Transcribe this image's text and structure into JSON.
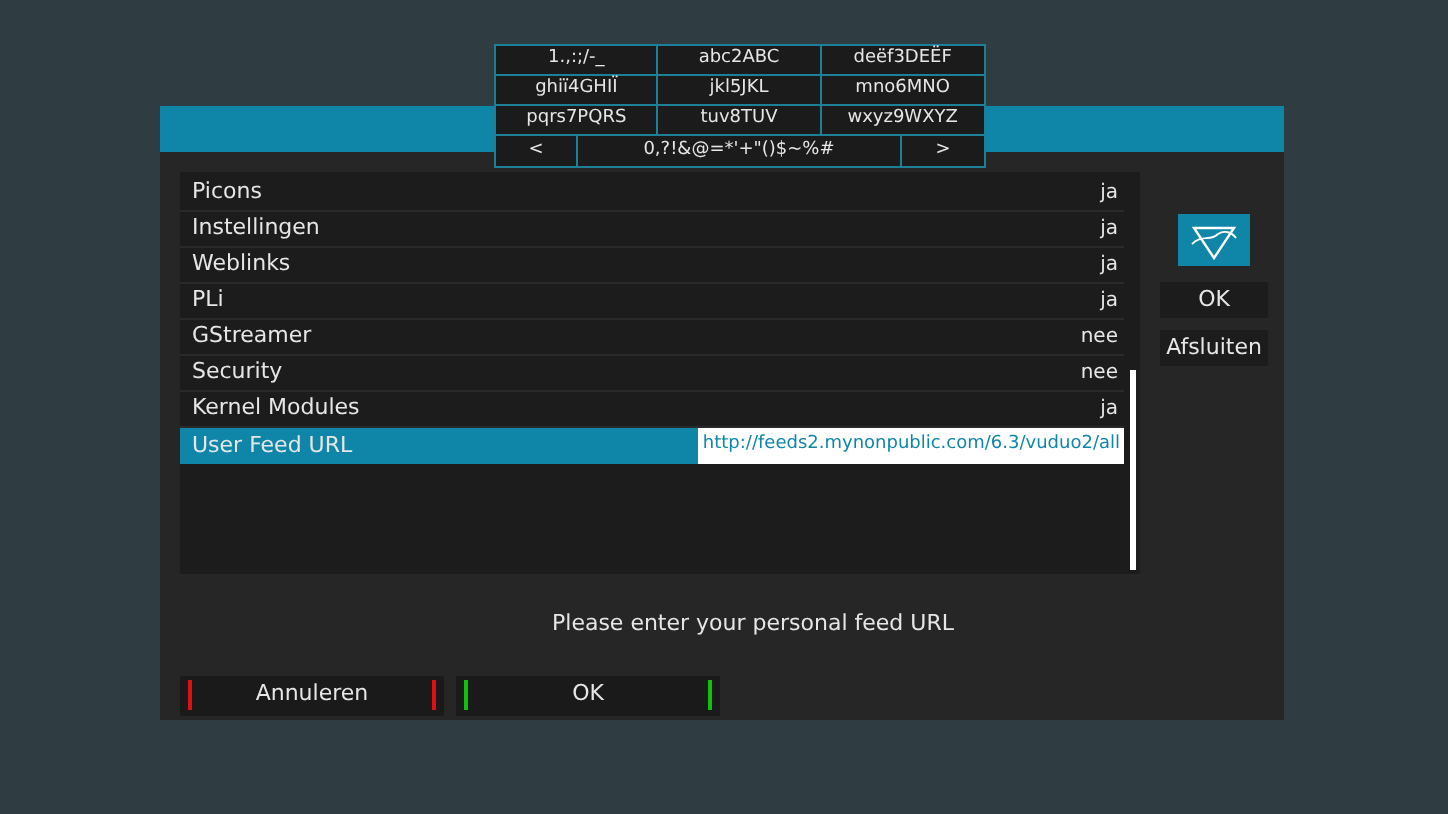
{
  "keyboard": {
    "rows": [
      [
        "1.,:;/-_",
        "abc2ABC",
        "deëf3DEËF"
      ],
      [
        "ghiï4GHIÏ",
        "jkl5JKL",
        "mno6MNO"
      ],
      [
        "pqrs7PQRS",
        "tuv8TUV",
        "wxyz9WXYZ"
      ],
      [
        "<",
        "0,?!&@=*'+\"()$~%#",
        ">"
      ]
    ]
  },
  "settings": [
    {
      "label": "Picons",
      "value": "ja",
      "kind": "choice",
      "selected": false
    },
    {
      "label": "Instellingen",
      "value": "ja",
      "kind": "choice",
      "selected": false
    },
    {
      "label": "Weblinks",
      "value": "ja",
      "kind": "choice",
      "selected": false
    },
    {
      "label": "PLi",
      "value": "ja",
      "kind": "choice",
      "selected": false
    },
    {
      "label": "GStreamer",
      "value": "nee",
      "kind": "choice",
      "selected": false
    },
    {
      "label": "Security",
      "value": "nee",
      "kind": "choice",
      "selected": false
    },
    {
      "label": "Kernel Modules",
      "value": "ja",
      "kind": "choice",
      "selected": false
    },
    {
      "label": "User Feed URL",
      "value": "http://feeds2.mynonpublic.com/6.3/vuduo2/all",
      "kind": "text",
      "selected": true
    }
  ],
  "side_buttons": [
    "OK",
    "Afsluiten"
  ],
  "hint": "Please enter your personal feed URL",
  "buttons": [
    {
      "label": "Annuleren",
      "color": "#e01010"
    },
    {
      "label": "OK",
      "color": "#10c010"
    }
  ]
}
